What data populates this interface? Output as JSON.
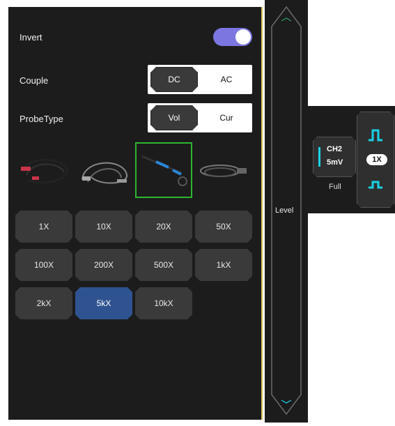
{
  "colors": {
    "toggle_on": "#7b76e0",
    "accent_blue": "#2e5390",
    "cyan": "#1ad1e6",
    "selected_border": "#2fb52f"
  },
  "invert": {
    "label": "Invert",
    "state": "on"
  },
  "couple": {
    "label": "Couple",
    "options": [
      "DC",
      "AC"
    ],
    "selected": "DC"
  },
  "probe_type": {
    "label": "ProbeType",
    "options": [
      "Vol",
      "Cur"
    ],
    "selected": "Vol"
  },
  "probe_images": [
    {
      "icon": "red-alligator-probe-icon"
    },
    {
      "icon": "black-bnc-probe-icon"
    },
    {
      "icon": "blue-voltage-probe-icon",
      "selected": true
    },
    {
      "icon": "current-clamp-probe-icon"
    }
  ],
  "multipliers": {
    "items": [
      "1X",
      "10X",
      "20X",
      "50X",
      "100X",
      "200X",
      "500X",
      "1kX",
      "2kX",
      "5kX",
      "10kX"
    ],
    "selected": "5kX"
  },
  "level": {
    "label": "Level"
  },
  "channel": {
    "name": "CH2",
    "volts": "5mV",
    "coupling": "Full"
  },
  "trigger": {
    "probe": "1X"
  }
}
